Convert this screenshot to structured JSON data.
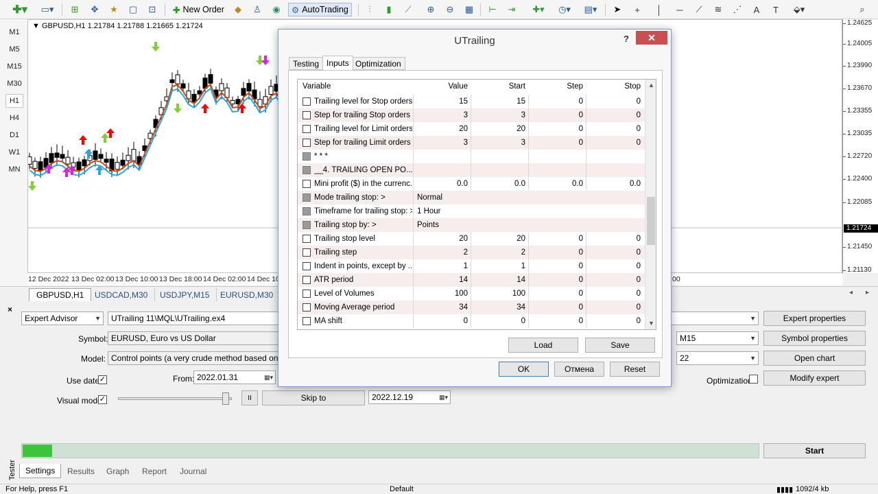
{
  "toolbar": {
    "new_order": "New Order",
    "autotrading": "AutoTrading",
    "icons": [
      "new-chart-icon",
      "profiles-icon",
      "market-watch-icon",
      "navigator-icon",
      "data-window-icon",
      "terminal-icon",
      "strategy-tester-icon",
      "new-order-icon",
      "metaeditor-icon",
      "signals-icon",
      "market-icon",
      "autotrading-icon",
      "bar-chart-icon",
      "candlestick-icon",
      "line-chart-icon",
      "zoom-in-icon",
      "zoom-out-icon",
      "tile-windows-icon",
      "chart-shift-icon",
      "autoscroll-icon",
      "indicators-icon",
      "periods-icon",
      "templates-icon",
      "cursor-icon",
      "crosshair-icon",
      "vertical-line-icon",
      "horizontal-line-icon",
      "trendline-icon",
      "fibonacci-icon",
      "text-icon",
      "text-label-icon",
      "arrows-icon",
      "search-icon"
    ]
  },
  "timeframes": [
    {
      "label": "M1",
      "active": false
    },
    {
      "label": "M5",
      "active": false
    },
    {
      "label": "M15",
      "active": false
    },
    {
      "label": "M30",
      "active": false
    },
    {
      "label": "H1",
      "active": true
    },
    {
      "label": "H4",
      "active": false
    },
    {
      "label": "D1",
      "active": false
    },
    {
      "label": "W1",
      "active": false
    },
    {
      "label": "MN",
      "active": false
    }
  ],
  "chart": {
    "header": "GBPUSD,H1  1.21784 1.21788 1.21665 1.21724",
    "price_labels": [
      "1.24625",
      "1.24005",
      "1.23990",
      "1.23670",
      "1.23355",
      "1.23035",
      "1.22720",
      "1.22400",
      "1.22085",
      "1.21724",
      "1.21450",
      "1.21130"
    ],
    "current_price": "1.21724",
    "time_labels": [
      "12 Dec 2022",
      "13 Dec 02:00",
      "13 Dec 10:00",
      "13 Dec 18:00",
      "14 Dec 02:00",
      "14 Dec 10:",
      "00"
    ],
    "colors": {
      "ma_fast": "#27a7e8",
      "ma_slow": "#c84a14",
      "arrow_up": "#ff0000",
      "arrow_buy": "#80d030",
      "arrow_magenta": "#e020e0"
    }
  },
  "chart_tabs": [
    {
      "label": "GBPUSD,H1",
      "active": true
    },
    {
      "label": "USDCAD,M30",
      "active": false
    },
    {
      "label": "USDJPY,M15",
      "active": false
    },
    {
      "label": "EURUSD,M30",
      "active": false
    }
  ],
  "tester": {
    "type": "Expert Advisor",
    "expert_path": "UTrailing 11\\MQL\\UTrailing.ex4",
    "symbol_label": "Symbol:",
    "symbol_value": "EURUSD, Euro vs US Dollar",
    "model_label": "Model:",
    "model_value": "Control points (a very crude method based on the ne",
    "use_date_label": "Use date",
    "from_label": "From:",
    "from_value": "2022.01.31",
    "visual_mode_label": "Visual mode",
    "skip_to": "Skip to",
    "skip_date": "2022.12.19",
    "period_value": "M15",
    "spread_value": "22",
    "optimization_label": "Optimization",
    "expert_properties": "Expert properties",
    "symbol_properties": "Symbol properties",
    "open_chart": "Open chart",
    "modify_expert": "Modify expert",
    "start": "Start",
    "pause_icon": "II",
    "progress_percent": 4,
    "side_label": "Tester",
    "close_glyph": "×",
    "tabs": [
      {
        "label": "Settings",
        "active": true
      },
      {
        "label": "Results",
        "active": false
      },
      {
        "label": "Graph",
        "active": false
      },
      {
        "label": "Report",
        "active": false
      },
      {
        "label": "Journal",
        "active": false
      }
    ]
  },
  "status": {
    "help": "For Help, press F1",
    "profile": "Default",
    "traffic": "1092/4 kb"
  },
  "dialog": {
    "title": "UTrailing",
    "help": "?",
    "close": "✕",
    "tabs": [
      {
        "label": "Testing",
        "active": false
      },
      {
        "label": "Inputs",
        "active": true
      },
      {
        "label": "Optimization",
        "active": false
      }
    ],
    "columns": [
      "Variable",
      "Value",
      "Start",
      "Step",
      "Stop"
    ],
    "rows": [
      {
        "name": "Trailing level for Stop orders",
        "value": "15",
        "start": "15",
        "step": "0",
        "stop": "0",
        "gray": false
      },
      {
        "name": "Step for trailing Stop orders",
        "value": "3",
        "start": "3",
        "step": "0",
        "stop": "0",
        "gray": false
      },
      {
        "name": "Trailing level for Limit orders",
        "value": "20",
        "start": "20",
        "step": "0",
        "stop": "0",
        "gray": false
      },
      {
        "name": "Step for trailing Limit orders",
        "value": "3",
        "start": "3",
        "step": "0",
        "stop": "0",
        "gray": false
      },
      {
        "name": "* * *",
        "value": "",
        "start": "",
        "step": "",
        "stop": "",
        "gray": true
      },
      {
        "name": "__4. TRAILING OPEN PO...",
        "value": "",
        "start": "",
        "step": "",
        "stop": "",
        "gray": true
      },
      {
        "name": "Mini profit ($) in the currenc...",
        "value": "0.0",
        "start": "0.0",
        "step": "0.0",
        "stop": "0.0",
        "gray": false
      },
      {
        "name": "Mode trailing stop: >",
        "value": "Normal",
        "start": "",
        "step": "",
        "stop": "",
        "gray": true,
        "text_value": true
      },
      {
        "name": "Timeframe for trailing stop: >",
        "value": "1 Hour",
        "start": "",
        "step": "",
        "stop": "",
        "gray": true,
        "text_value": true
      },
      {
        "name": "Trailing stop by: >",
        "value": "Points",
        "start": "",
        "step": "",
        "stop": "",
        "gray": true,
        "text_value": true
      },
      {
        "name": "Trailing stop level",
        "value": "20",
        "start": "20",
        "step": "0",
        "stop": "0",
        "gray": false
      },
      {
        "name": "Trailing step",
        "value": "2",
        "start": "2",
        "step": "0",
        "stop": "0",
        "gray": false
      },
      {
        "name": "Indent in points, except by ...",
        "value": "1",
        "start": "1",
        "step": "0",
        "stop": "0",
        "gray": false
      },
      {
        "name": "ATR period",
        "value": "14",
        "start": "14",
        "step": "0",
        "stop": "0",
        "gray": false
      },
      {
        "name": "Level of Volumes",
        "value": "100",
        "start": "100",
        "step": "0",
        "stop": "0",
        "gray": false
      },
      {
        "name": "Moving Average period",
        "value": "34",
        "start": "34",
        "step": "0",
        "stop": "0",
        "gray": false
      },
      {
        "name": "MA shift",
        "value": "0",
        "start": "0",
        "step": "0",
        "stop": "0",
        "gray": false
      }
    ],
    "load": "Load",
    "save": "Save",
    "ok": "OK",
    "cancel": "Отмена",
    "reset": "Reset"
  }
}
